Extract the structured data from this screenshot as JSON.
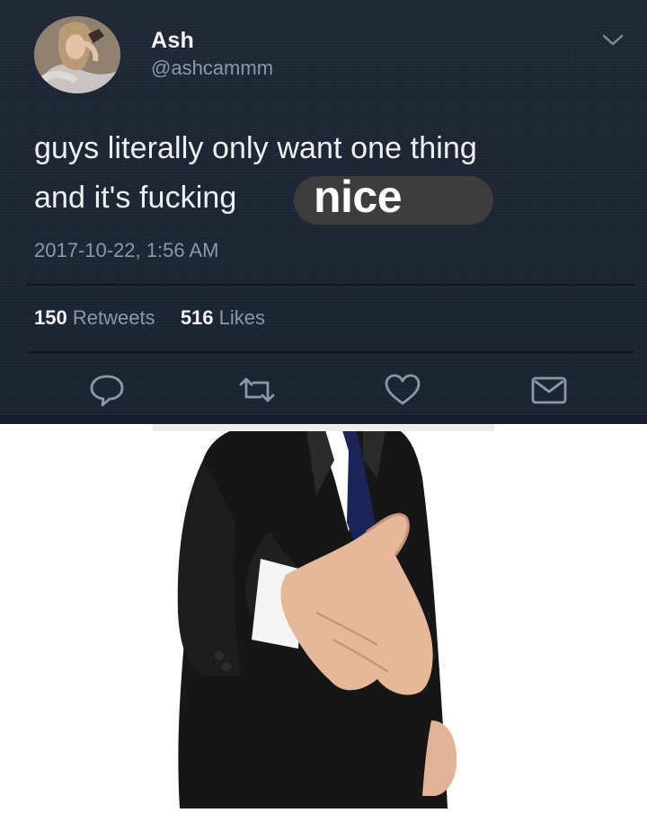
{
  "tweet": {
    "display_name": "Ash",
    "handle": "@ashcammm",
    "text_line1": "guys literally only want one thing",
    "text_line2": "and it's fucking",
    "highlight_word": "nice",
    "timestamp": "2017-10-22, 1:56 AM",
    "retweets_count": "150",
    "retweets_label": "Retweets",
    "likes_count": "516",
    "likes_label": "Likes"
  },
  "icons": {
    "menu": "chevron-down-icon",
    "reply": "reply-icon",
    "retweet": "retweet-icon",
    "like": "heart-icon",
    "message": "envelope-icon"
  },
  "colors": {
    "tweet_background": "#1c2433",
    "primary_text": "#eef1f5",
    "secondary_text": "#8b98a8",
    "highlight_pill": "#3d3d3d"
  }
}
